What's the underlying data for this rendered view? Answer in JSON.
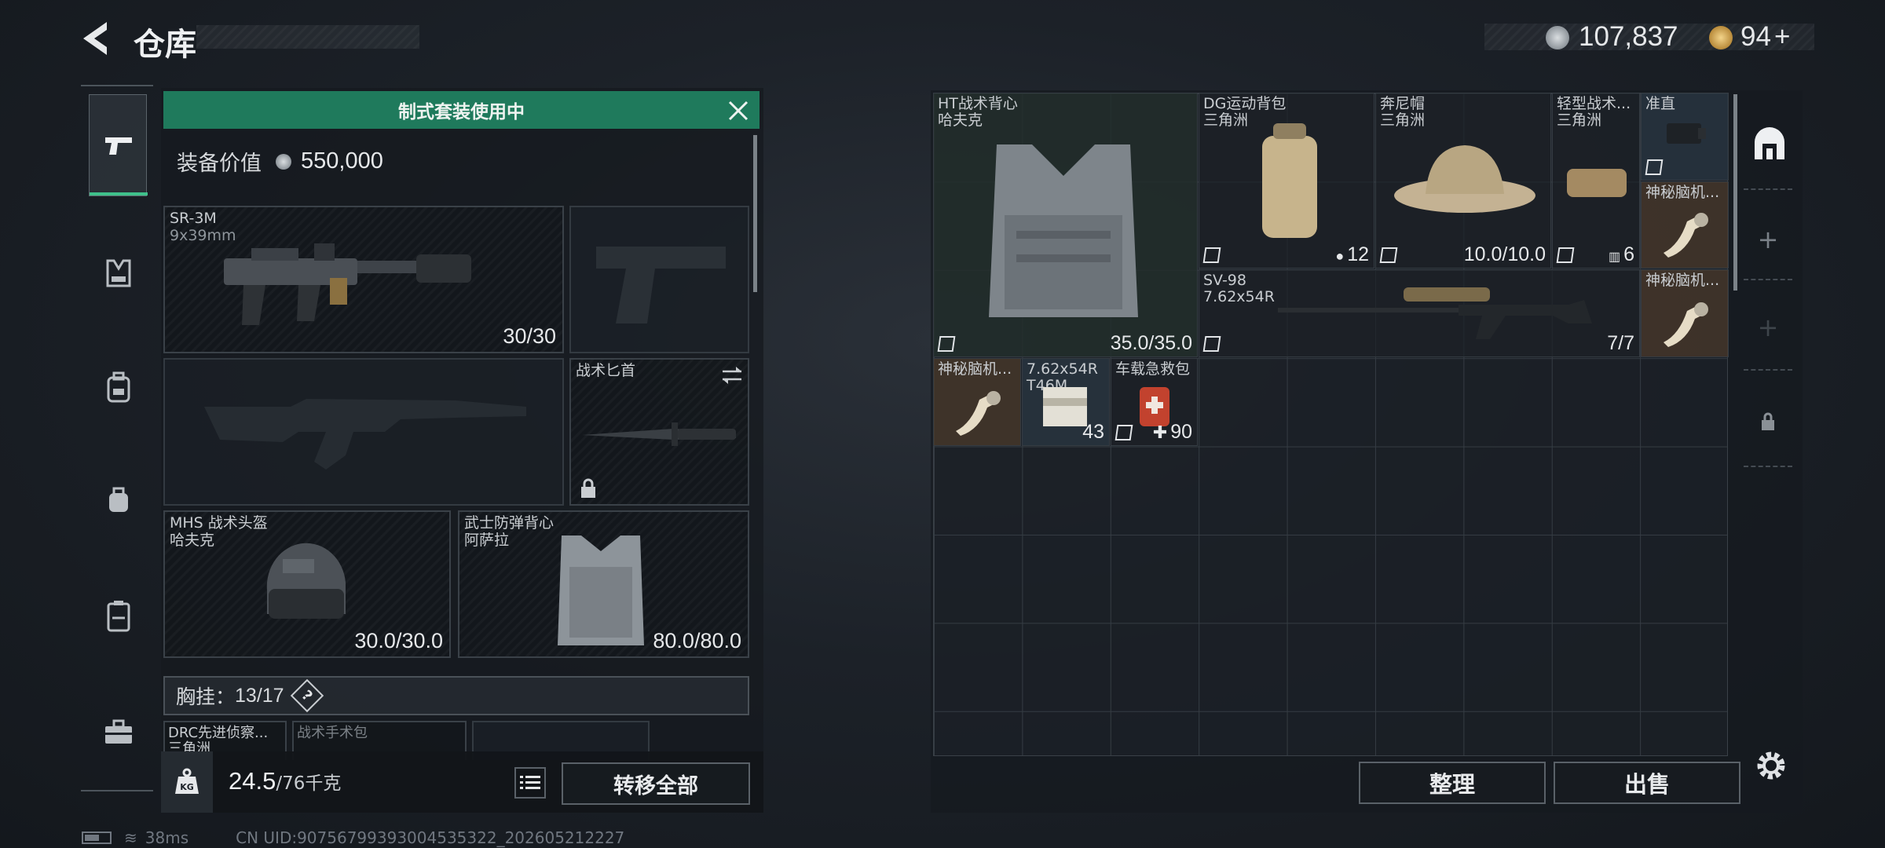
{
  "header": {
    "title": "仓库",
    "currency": [
      {
        "amount": "107,837",
        "icon": "silver-coin-icon"
      },
      {
        "amount": "94",
        "suffix": "+",
        "icon": "gold-coin-icon"
      }
    ]
  },
  "sidebar": {
    "tabs": [
      {
        "name": "weapons",
        "icon": "pistol-icon",
        "active": true
      },
      {
        "name": "armor",
        "icon": "vest-icon"
      },
      {
        "name": "backpack-1",
        "icon": "backpack-icon"
      },
      {
        "name": "backpack-2",
        "icon": "small-backpack-icon"
      },
      {
        "name": "case",
        "icon": "case-icon"
      },
      {
        "name": "toolbox",
        "icon": "toolbox-icon"
      }
    ]
  },
  "loadout": {
    "banner": "制式套装使用中",
    "equip_value_label": "装备价值",
    "equip_value": "550,000",
    "primary": {
      "name": "SR-3M",
      "caliber": "9x39mm",
      "ammo": "30/30"
    },
    "melee": {
      "name": "战术匕首"
    },
    "helmet": {
      "name": "MHS 战术头盔",
      "brand": "哈夫克",
      "durability": "30.0/30.0"
    },
    "armor": {
      "name": "武士防弹背心",
      "brand": "阿萨拉",
      "durability": "80.0/80.0"
    },
    "chest_rig": {
      "label": "胸挂：",
      "count": "13/17",
      "help": "?"
    },
    "sub_items": [
      "DRC先进侦察...",
      "战术手术包"
    ],
    "sub_item_brand": "三角洲",
    "weight": "24.5",
    "weight_max": "/76千克",
    "transfer_all": "转移全部",
    "weight_icon": "kg-weight-icon"
  },
  "inventory": {
    "items": [
      {
        "name": "HT战术背心",
        "brand": "哈夫克",
        "value": "35.0/35.0"
      },
      {
        "name": "DG运动背包",
        "brand": "三角洲",
        "value": "12"
      },
      {
        "name": "奔尼帽",
        "brand": "三角洲",
        "value": "10.0/10.0"
      },
      {
        "name": "轻型战术...",
        "brand": "三角洲",
        "value": "6"
      },
      {
        "name": "准直"
      },
      {
        "name": "神秘脑机..."
      },
      {
        "name": "SV-98",
        "caliber": "7.62x54R",
        "value": "7/7"
      },
      {
        "name": "神秘脑机..."
      },
      {
        "name": "神秘脑机..."
      },
      {
        "name": "7.62x54R",
        "sub": "T46M",
        "value": "43"
      },
      {
        "name": "车载急救包",
        "value": "90"
      }
    ],
    "organize": "整理",
    "sell": "出售"
  },
  "right_rail": {
    "icons": [
      "storage-icon",
      "plus-icon",
      "plus-icon",
      "lock-icon"
    ]
  },
  "status": {
    "ping": "38ms",
    "uid": "CN UID:9075679939300453532​2_202605212227"
  },
  "colors": {
    "banner_green": "#1f7a5c",
    "active_tab": "#3fc18b",
    "brown_cell": "#48382a"
  }
}
